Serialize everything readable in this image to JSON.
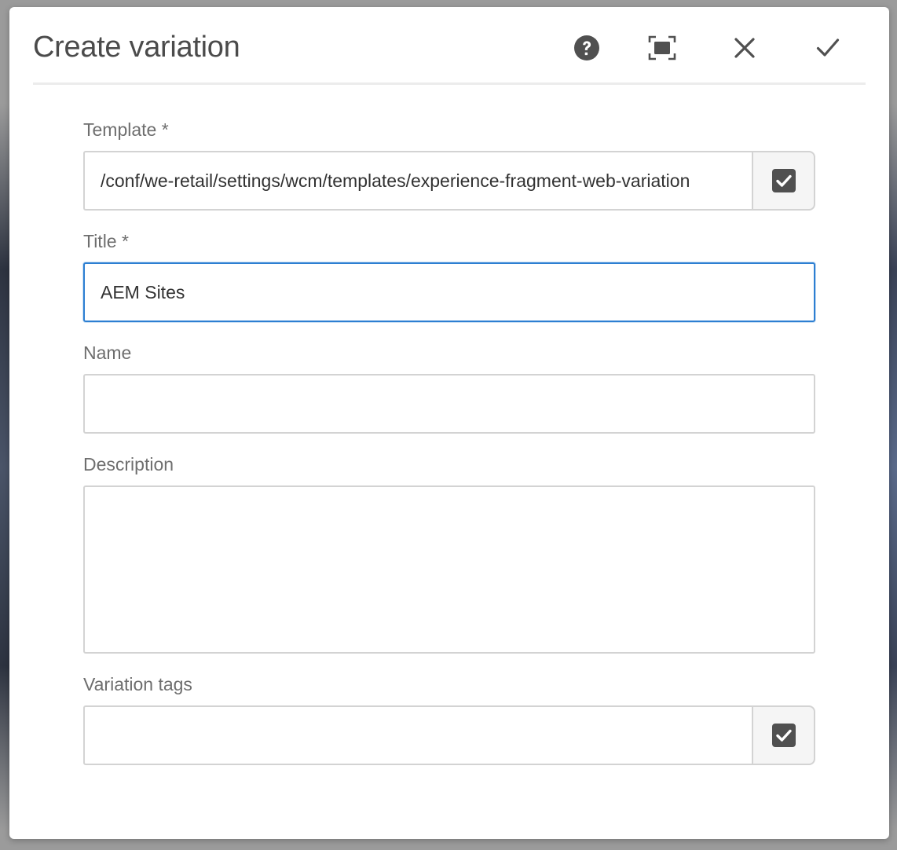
{
  "dialog": {
    "title": "Create variation",
    "actions": {
      "help_icon": "help-circle-icon",
      "fullscreen_icon": "fullscreen-icon",
      "close_icon": "close-icon",
      "done_icon": "checkmark-icon"
    }
  },
  "form": {
    "template": {
      "label": "Template *",
      "value": "/conf/we-retail/settings/wcm/templates/experience-fragment-web-variation",
      "picker_icon": "checkbox-checked-icon"
    },
    "title": {
      "label": "Title *",
      "value": "AEM Sites"
    },
    "name": {
      "label": "Name",
      "value": ""
    },
    "description": {
      "label": "Description",
      "value": ""
    },
    "variation_tags": {
      "label": "Variation tags",
      "value": "",
      "picker_icon": "checkbox-checked-icon"
    }
  },
  "colors": {
    "focus_border": "#2d7fd2",
    "icon": "#505050",
    "label": "#6e6e6e"
  }
}
